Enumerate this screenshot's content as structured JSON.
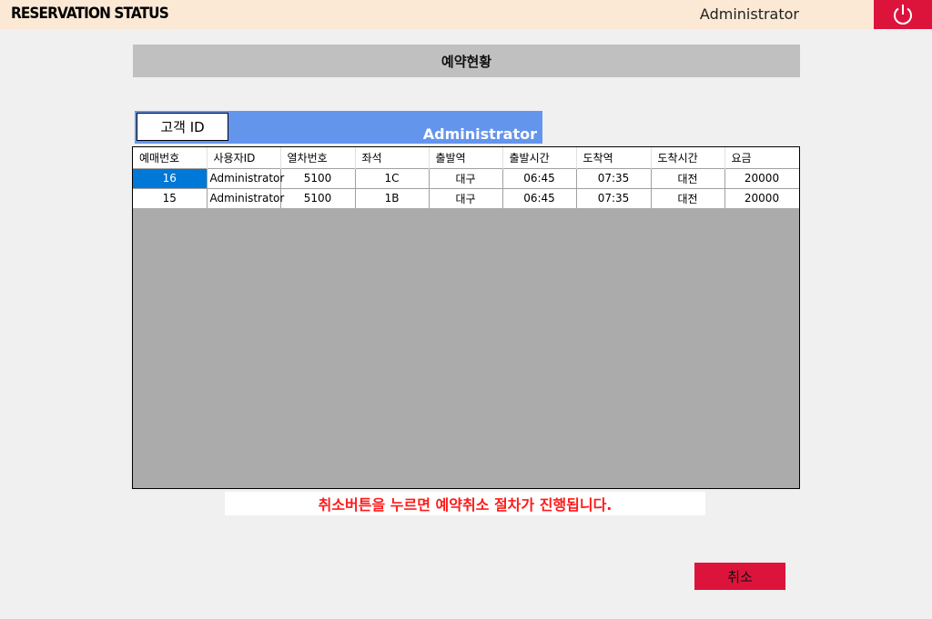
{
  "header": {
    "title": "RESERVATION STATUS",
    "user": "Administrator",
    "power_icon": "power-icon",
    "accent_color": "#dc143c"
  },
  "page": {
    "heading": "예약현황"
  },
  "customer": {
    "id_label": "고객 ID",
    "id_value": "Administrator"
  },
  "table": {
    "columns": [
      "예매번호",
      "사용자ID",
      "열차번호",
      "좌석",
      "출발역",
      "출발시간",
      "도착역",
      "도착시간",
      "요금"
    ],
    "rows": [
      [
        "16",
        "Administrator",
        "5100",
        "1C",
        "대구",
        "06:45",
        "07:35",
        "대전",
        "20000"
      ],
      [
        "15",
        "Administrator",
        "5100",
        "1B",
        "대구",
        "06:45",
        "07:35",
        "대전",
        "20000"
      ]
    ],
    "selected_row": 0
  },
  "notice": "취소버튼을 누르면 예약취소 절차가 진행됩니다.",
  "actions": {
    "cancel_label": "취소"
  }
}
